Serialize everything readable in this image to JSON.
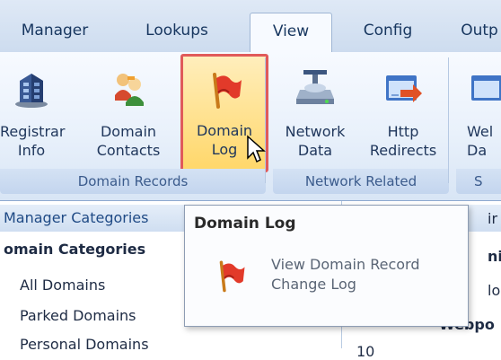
{
  "tabs": [
    {
      "label": "Manager",
      "active": false
    },
    {
      "label": "Lookups",
      "active": false
    },
    {
      "label": "View",
      "active": true
    },
    {
      "label": "Config",
      "active": false
    },
    {
      "label": "Outp",
      "active": false
    }
  ],
  "ribbon": {
    "groups": [
      {
        "name": "Domain Records",
        "buttons": [
          {
            "label": "Registrar\nInfo",
            "icon": "registrar-building-icon"
          },
          {
            "label": "Domain\nContacts",
            "icon": "contacts-people-icon"
          },
          {
            "label": "Domain\nLog",
            "icon": "red-flag-icon",
            "selected": true
          }
        ]
      },
      {
        "name": "Network Related",
        "buttons": [
          {
            "label": "Network\nData",
            "icon": "network-drive-icon"
          },
          {
            "label": "Http\nRedirects",
            "icon": "redirect-arrow-icon"
          }
        ]
      },
      {
        "name": "S",
        "buttons": [
          {
            "label": "Wel\nDa",
            "icon": "web-data-icon"
          }
        ]
      }
    ]
  },
  "left_pane": {
    "header": "Manager Categories",
    "group_label": "omain Categories",
    "items": [
      "All Domains",
      "Parked Domains",
      "Personal Domains"
    ]
  },
  "right_pane": {
    "fragments": [
      "ir",
      "ni",
      "lo",
      "Webpo",
      "10"
    ]
  },
  "tooltip": {
    "title": "Domain Log",
    "description": "View Domain Record\nChange Log",
    "icon": "red-flag-icon"
  },
  "colors": {
    "accent_red": "#e05a5a",
    "selected_fill": "#ffd76a",
    "ribbon_text": "#20375c"
  }
}
